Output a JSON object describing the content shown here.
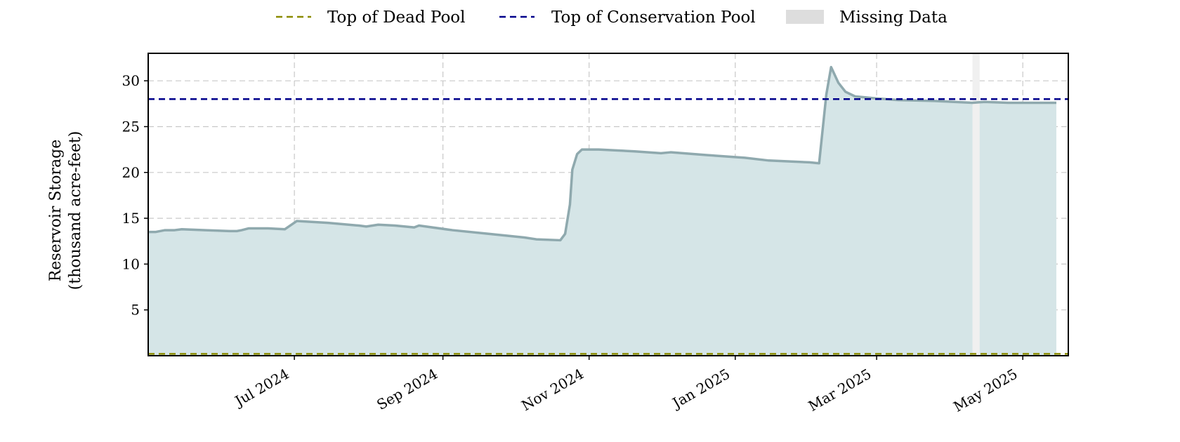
{
  "chart_data": {
    "type": "area",
    "title": "",
    "xlabel": "",
    "ylabel_lines": [
      "Reservoir Storage",
      "(thousand acre-feet)"
    ],
    "x_range": [
      "2024-05-01",
      "2025-05-20"
    ],
    "ylim": [
      0,
      33
    ],
    "y_ticks": [
      5,
      10,
      15,
      20,
      25,
      30
    ],
    "x_ticks": [
      {
        "date": "2024-07-01",
        "label": "Jul 2024"
      },
      {
        "date": "2024-09-01",
        "label": "Sep 2024"
      },
      {
        "date": "2024-11-01",
        "label": "Nov 2024"
      },
      {
        "date": "2025-01-01",
        "label": "Jan 2025"
      },
      {
        "date": "2025-03-01",
        "label": "Mar 2025"
      },
      {
        "date": "2025-05-01",
        "label": "May 2025"
      }
    ],
    "grid": true,
    "legend_placement": "top-center",
    "legend": [
      {
        "label": "Top of Dead Pool",
        "kind": "dashed-line",
        "color": "#8b8b00"
      },
      {
        "label": "Top of Conservation Pool",
        "kind": "dashed-line",
        "color": "#00008b"
      },
      {
        "label": "Missing Data",
        "kind": "patch",
        "color": "#dddddd"
      }
    ],
    "reference_lines": [
      {
        "label": "Top of Dead Pool",
        "y": 0.2,
        "color": "#8b8b00"
      },
      {
        "label": "Top of Conservation Pool",
        "y": 28.0,
        "color": "#00008b"
      }
    ],
    "missing_data": [
      {
        "start": "2025-04-10",
        "end": "2025-04-13"
      }
    ],
    "series": [
      {
        "color": "#8fa9ae",
        "fill_color": "#d5e5e7",
        "points": [
          [
            "2024-05-01",
            13.5
          ],
          [
            "2024-05-04",
            13.5
          ],
          [
            "2024-05-08",
            13.7
          ],
          [
            "2024-05-12",
            13.7
          ],
          [
            "2024-05-15",
            13.8
          ],
          [
            "2024-05-25",
            13.7
          ],
          [
            "2024-06-04",
            13.6
          ],
          [
            "2024-06-07",
            13.6
          ],
          [
            "2024-06-09",
            13.7
          ],
          [
            "2024-06-12",
            13.9
          ],
          [
            "2024-06-20",
            13.9
          ],
          [
            "2024-06-27",
            13.8
          ],
          [
            "2024-07-02",
            14.7
          ],
          [
            "2024-07-15",
            14.5
          ],
          [
            "2024-07-28",
            14.2
          ],
          [
            "2024-07-31",
            14.1
          ],
          [
            "2024-08-05",
            14.3
          ],
          [
            "2024-08-12",
            14.2
          ],
          [
            "2024-08-20",
            14.0
          ],
          [
            "2024-08-22",
            14.2
          ],
          [
            "2024-09-05",
            13.7
          ],
          [
            "2024-09-20",
            13.3
          ],
          [
            "2024-10-05",
            12.9
          ],
          [
            "2024-10-10",
            12.7
          ],
          [
            "2024-10-20",
            12.6
          ],
          [
            "2024-10-22",
            13.3
          ],
          [
            "2024-10-24",
            16.5
          ],
          [
            "2024-10-25",
            20.3
          ],
          [
            "2024-10-27",
            22.0
          ],
          [
            "2024-10-29",
            22.5
          ],
          [
            "2024-11-05",
            22.5
          ],
          [
            "2024-11-20",
            22.3
          ],
          [
            "2024-12-01",
            22.1
          ],
          [
            "2024-12-05",
            22.2
          ],
          [
            "2024-12-20",
            21.9
          ],
          [
            "2025-01-05",
            21.6
          ],
          [
            "2025-01-15",
            21.3
          ],
          [
            "2025-02-01",
            21.1
          ],
          [
            "2025-02-05",
            21.0
          ],
          [
            "2025-02-08",
            28.5
          ],
          [
            "2025-02-10",
            31.5
          ],
          [
            "2025-02-13",
            29.8
          ],
          [
            "2025-02-16",
            28.8
          ],
          [
            "2025-02-20",
            28.3
          ],
          [
            "2025-02-28",
            28.1
          ],
          [
            "2025-03-10",
            27.9
          ],
          [
            "2025-03-25",
            27.8
          ],
          [
            "2025-04-10",
            27.6
          ],
          [
            "2025-04-15",
            27.7
          ],
          [
            "2025-04-25",
            27.6
          ],
          [
            "2025-05-10",
            27.6
          ],
          [
            "2025-05-15",
            27.6
          ]
        ]
      }
    ]
  }
}
